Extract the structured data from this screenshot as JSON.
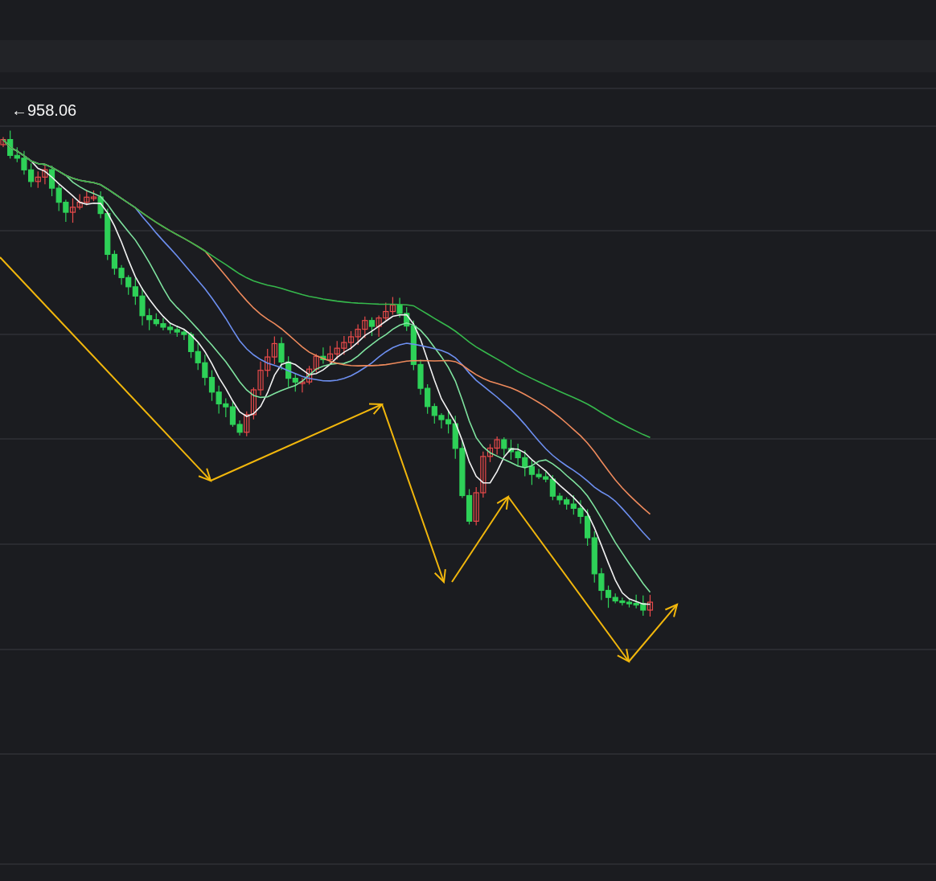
{
  "chart": {
    "high_label": "←958.06"
  }
}
